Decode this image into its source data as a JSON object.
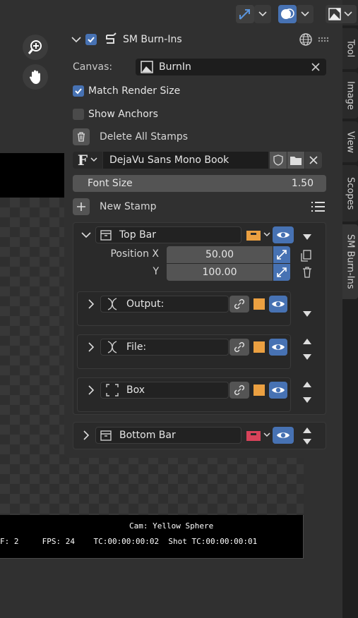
{
  "panel": {
    "title": "SM Burn-Ins",
    "canvas_label": "Canvas:",
    "canvas_value": "BurnIn",
    "match_render_size": "Match Render Size",
    "show_anchors": "Show Anchors",
    "delete_all_stamps": "Delete All Stamps",
    "font_name": "DejaVu Sans Mono Book",
    "font_size_label": "Font Size",
    "font_size_value": "1.50",
    "new_stamp": "New Stamp"
  },
  "top_bar": {
    "name": "Top Bar",
    "position_x_label": "Position X",
    "position_x_value": "50.00",
    "y_label": "Y",
    "y_value": "100.00",
    "items": [
      {
        "name": "Output:"
      },
      {
        "name": "File:"
      },
      {
        "name": "Box"
      }
    ]
  },
  "bottom_bar": {
    "name": "Bottom Bar"
  },
  "tabs": [
    "Tool",
    "Image",
    "View",
    "Scopes",
    "SM Burn-Ins"
  ],
  "burnin": {
    "line1": "Cam: Yellow Sphere",
    "line2": "F: 2     FPS: 24    TC:00:00:00:02  Shot TC:00:00:00:01"
  },
  "colors": {
    "accent": "#4772b3",
    "stamp_color": "#eba041",
    "bottom_bar_color": "#d8435a"
  }
}
